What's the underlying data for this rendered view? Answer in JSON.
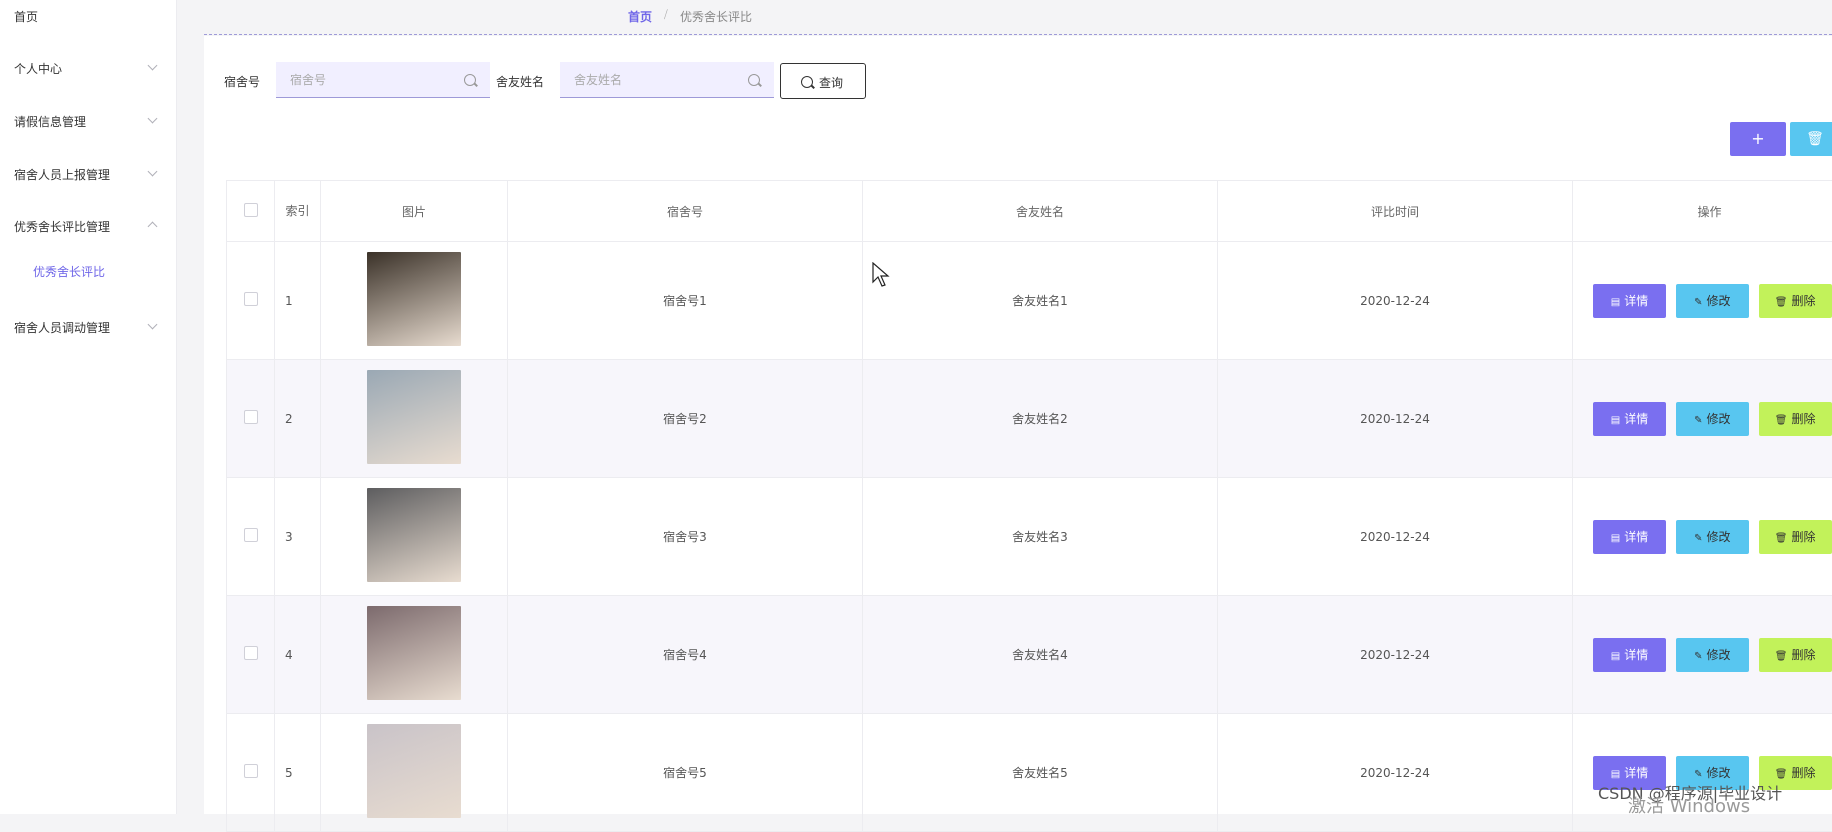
{
  "sidebar": {
    "items": [
      {
        "label": "首页"
      },
      {
        "label": "个人中心"
      },
      {
        "label": "请假信息管理"
      },
      {
        "label": "宿舍人员上报管理"
      },
      {
        "label": "优秀舍长评比管理"
      },
      {
        "label": "宿舍人员调动管理"
      }
    ],
    "sub_active": "优秀舍长评比"
  },
  "breadcrumb": {
    "home": "首页",
    "current": "优秀舍长评比"
  },
  "filters": {
    "dorm_label": "宿舍号",
    "dorm_placeholder": "宿舍号",
    "name_label": "舍友姓名",
    "name_placeholder": "舍友姓名",
    "query_label": "查询"
  },
  "toolbar": {
    "add": "+",
    "delete": "🗑"
  },
  "table": {
    "headers": {
      "index": "索引",
      "image": "图片",
      "dorm": "宿舍号",
      "name": "舍友姓名",
      "time": "评比时间",
      "ops": "操作"
    },
    "rows": [
      {
        "index": "1",
        "dorm": "宿舍号1",
        "name": "舍友姓名1",
        "time": "2020-12-24",
        "photo": "#3a3128"
      },
      {
        "index": "2",
        "dorm": "宿舍号2",
        "name": "舍友姓名2",
        "time": "2020-12-24",
        "photo": "#9aa8b4"
      },
      {
        "index": "3",
        "dorm": "宿舍号3",
        "name": "舍友姓名3",
        "time": "2020-12-24",
        "photo": "#5d5d5f"
      },
      {
        "index": "4",
        "dorm": "宿舍号4",
        "name": "舍友姓名4",
        "time": "2020-12-24",
        "photo": "#7c6a6d"
      },
      {
        "index": "5",
        "dorm": "宿舍号5",
        "name": "舍友姓名5",
        "time": "2020-12-24",
        "photo": "#c9c3c8"
      }
    ],
    "actions": {
      "detail": "详情",
      "edit": "修改",
      "delete": "删除"
    }
  },
  "watermark": {
    "csdn": "CSDN @程序源|毕业设计",
    "windows": "激活 Windows"
  }
}
